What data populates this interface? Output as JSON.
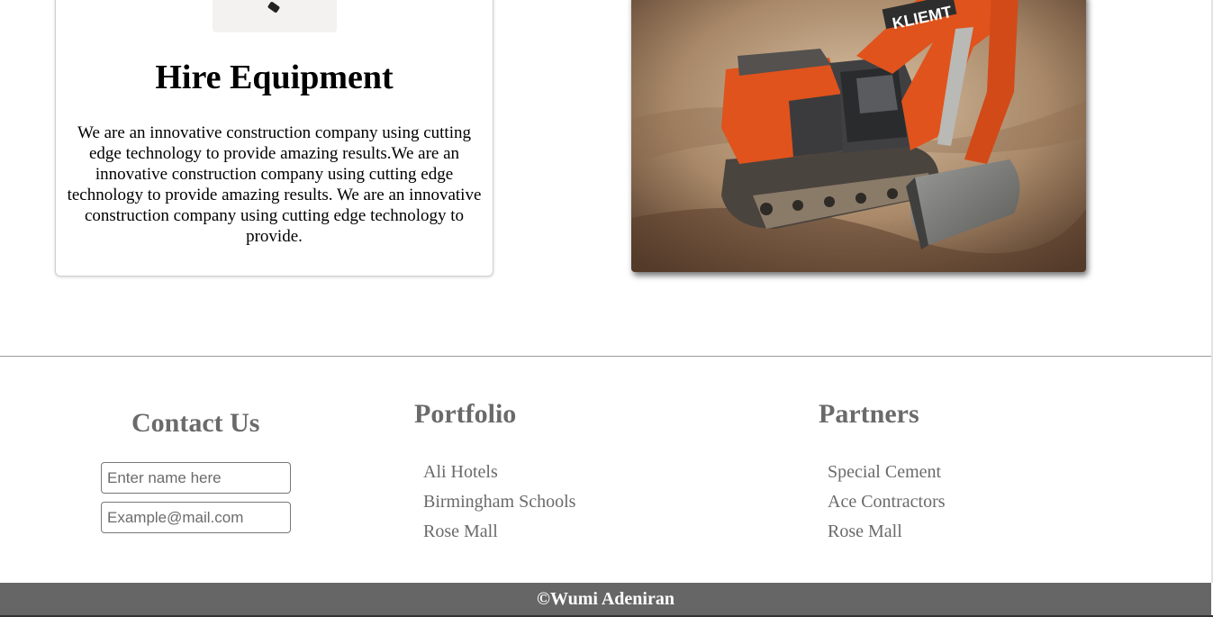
{
  "service_card": {
    "icon": "equipment-icon",
    "title": "Hire Equipment",
    "description": "We are an innovative construction company using cutting edge technology to provide amazing results.We are an innovative construction company using cutting edge technology to provide amazing results. We are an innovative construction company using cutting edge technology to provide."
  },
  "hero_image": {
    "brand_text": "KLIEMT",
    "colors": {
      "machine": "#e0531c",
      "ground": "#9a7a5c",
      "cab": "#3b3b3d"
    }
  },
  "footer": {
    "contact": {
      "heading": "Contact Us",
      "name_placeholder": "Enter name here",
      "email_placeholder": "Example@mail.com"
    },
    "portfolio": {
      "heading": "Portfolio",
      "items": [
        "Ali Hotels",
        "Birmingham Schools",
        "Rose Mall"
      ]
    },
    "partners": {
      "heading": "Partners",
      "items": [
        "Special Cement",
        "Ace Contractors",
        "Rose Mall"
      ]
    },
    "copyright": "©Wumi Adeniran"
  },
  "colors": {
    "footer_bar": "#666666",
    "heading_gray": "#6a6a6a"
  }
}
